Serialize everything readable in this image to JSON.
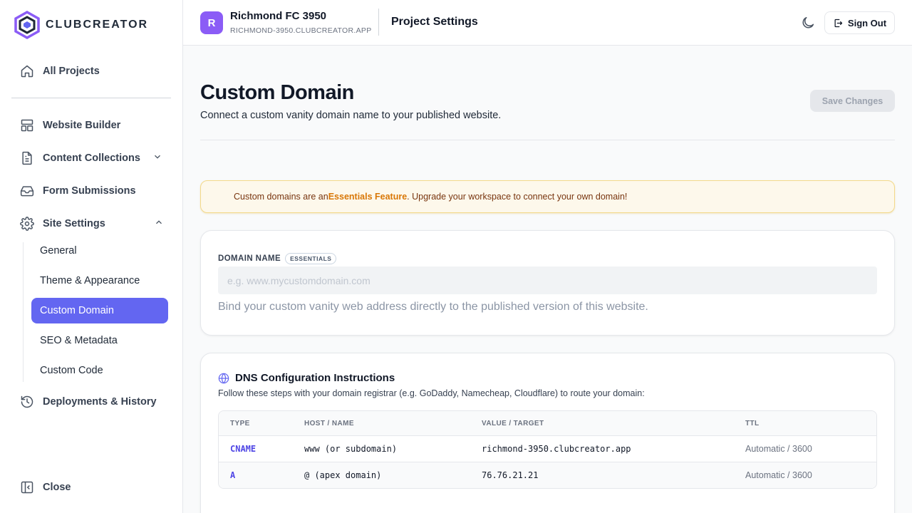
{
  "brand": {
    "name": "CLUBCREATOR"
  },
  "sidebar": {
    "all_projects": "All Projects",
    "items": [
      {
        "label": "Website Builder"
      },
      {
        "label": "Content Collections"
      },
      {
        "label": "Form Submissions"
      },
      {
        "label": "Site Settings"
      },
      {
        "label": "Deployments & History"
      }
    ],
    "site_settings_sub": [
      {
        "label": "General"
      },
      {
        "label": "Theme & Appearance"
      },
      {
        "label": "Custom Domain"
      },
      {
        "label": "SEO & Metadata"
      },
      {
        "label": "Custom Code"
      }
    ],
    "close": "Close"
  },
  "topbar": {
    "avatar_letter": "R",
    "project_name": "Richmond FC 3950",
    "project_domain": "RICHMOND-3950.CLUBCREATOR.APP",
    "page_title": "Project Settings",
    "sign_out": "Sign Out"
  },
  "main": {
    "title": "Custom Domain",
    "subtitle": "Connect a custom vanity domain name to your published website.",
    "save_button": "Save Changes",
    "alert": {
      "before": "Custom domains are an ",
      "highlight": "Essentials Feature",
      "after": ". Upgrade your workspace to connect your own domain!"
    },
    "domain_field": {
      "label": "DOMAIN NAME",
      "badge": "ESSENTIALS",
      "placeholder": "e.g. www.mycustomdomain.com",
      "value": "",
      "help": "Bind your custom vanity web address directly to the published version of this website."
    },
    "dns": {
      "title": "DNS Configuration Instructions",
      "subtitle": "Follow these steps with your domain registrar (e.g. GoDaddy, Namecheap, Cloudflare) to route your domain:",
      "headers": [
        "TYPE",
        "HOST / NAME",
        "VALUE / TARGET",
        "TTL"
      ],
      "rows": [
        {
          "type": "CNAME",
          "host": "www (or subdomain)",
          "value": "richmond-3950.clubcreator.app",
          "ttl": "Automatic / 3600"
        },
        {
          "type": "A",
          "host": "@ (apex domain)",
          "value": "76.76.21.21",
          "ttl": "Automatic / 3600"
        }
      ]
    }
  },
  "colors": {
    "accent": "#6366f1",
    "avatar": "#8b5cf6",
    "warning": "#d97706"
  }
}
